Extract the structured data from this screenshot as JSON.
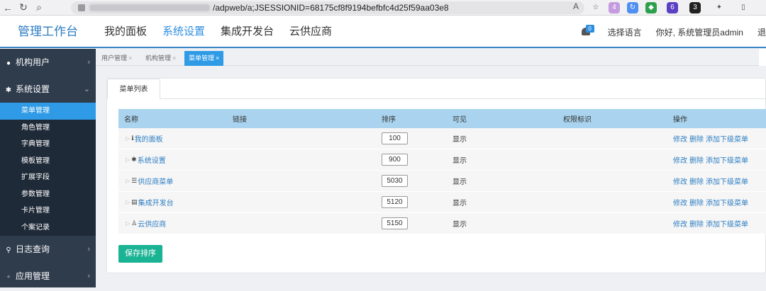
{
  "browser": {
    "url_path": "/adpweb/a;JSESSIONID=68175cf8f9194befbfc4d25f59aa03e8",
    "reader_icon": "A",
    "extensions": [
      "4",
      "6",
      "3"
    ]
  },
  "header": {
    "brand": "管理工作台",
    "nav": [
      "我的面板",
      "系统设置",
      "集成开发台",
      "云供应商"
    ],
    "active_nav": 1,
    "notification_count": "0",
    "language": "选择语言",
    "greeting": "你好, 系统管理员admin",
    "logout": "退"
  },
  "sidebar": {
    "groups": [
      {
        "icon": "user-icon",
        "label": "机构用户",
        "chevron": "›"
      },
      {
        "icon": "gear-icon",
        "label": "系统设置",
        "chevron": "⌄"
      }
    ],
    "items": [
      "菜单管理",
      "角色管理",
      "字典管理",
      "模板管理",
      "扩展字段",
      "参数管理",
      "卡片管理",
      "个案记录"
    ],
    "bottom_groups": [
      {
        "icon": "search-icon",
        "label": "日志查询",
        "chevron": "›"
      },
      {
        "icon": "app-icon",
        "label": "应用管理",
        "chevron": "›"
      }
    ]
  },
  "tabs": [
    {
      "label": "用户管理",
      "close": "×"
    },
    {
      "label": "机构管理",
      "close": "×"
    },
    {
      "label": "菜单管理",
      "close": "×"
    }
  ],
  "panel": {
    "tab_label": "菜单列表",
    "columns": [
      "名称",
      "链接",
      "排序",
      "可见",
      "权限标识",
      "操作"
    ],
    "rows": [
      {
        "icon": "info-icon",
        "name": "我的面板",
        "order": "100",
        "visible": "显示"
      },
      {
        "icon": "gear-icon",
        "name": "系统设置",
        "order": "900",
        "visible": "显示"
      },
      {
        "icon": "list-icon",
        "name": "供应商菜单",
        "order": "5030",
        "visible": "显示"
      },
      {
        "icon": "list-alt-icon",
        "name": "集成开发台",
        "order": "5120",
        "visible": "显示"
      },
      {
        "icon": "user-icon",
        "name": "云供应商",
        "order": "5150",
        "visible": "显示"
      }
    ],
    "ops": {
      "edit": "修改",
      "delete": "删除",
      "add_child": "添加下级菜单"
    },
    "save_button": "保存排序"
  },
  "colors": {
    "accent": "#2f9ae5",
    "sidebar_bg": "#2f3c4c",
    "table_header": "#a9d3ee",
    "save_green": "#1ab394"
  }
}
